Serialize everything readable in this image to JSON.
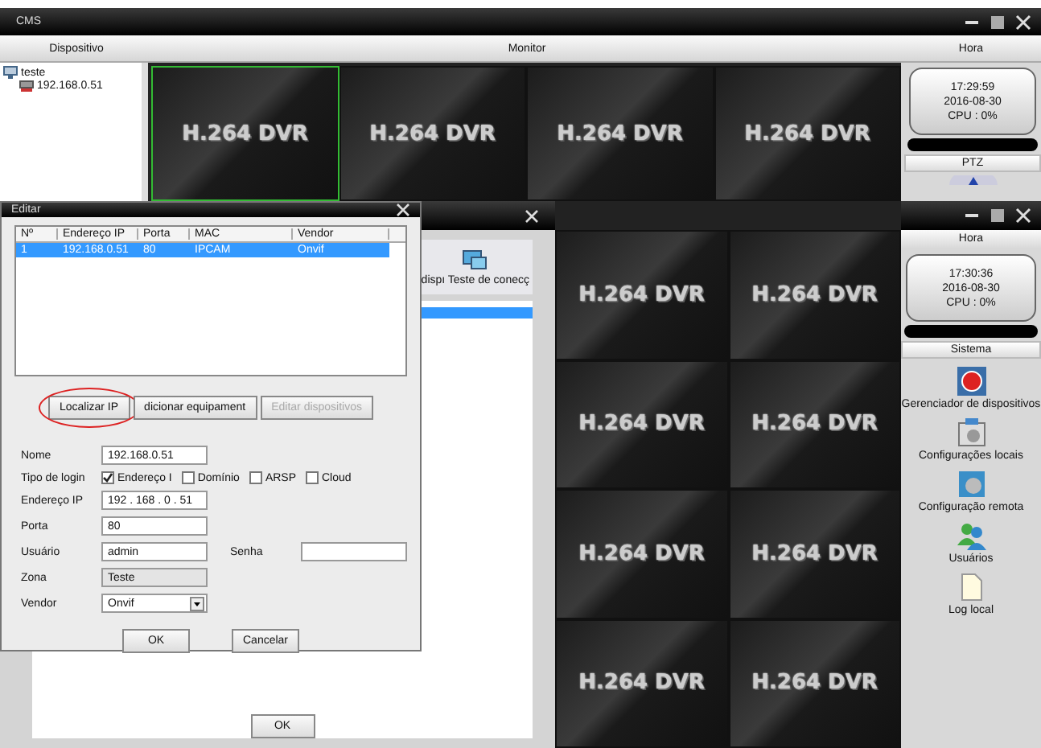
{
  "top_window": {
    "title": "CMS",
    "headers": [
      "Dispositivo",
      "Monitor",
      "Hora"
    ],
    "tree": [
      {
        "label": "teste",
        "children": [
          {
            "label": "192.168.0.51"
          }
        ]
      }
    ],
    "monitor_tiles": [
      {
        "label": "H.264 DVR",
        "selected": true
      },
      {
        "label": "H.264 DVR",
        "selected": false
      },
      {
        "label": "H.264 DVR",
        "selected": false
      },
      {
        "label": "H.264 DVR",
        "selected": false
      }
    ],
    "clock": {
      "time": "17:29:59",
      "date": "2016-08-30",
      "cpu": "CPU : 0%"
    },
    "ptz_label": "PTZ"
  },
  "bottom_window": {
    "device_window": {
      "toolbar_label": "dispı Teste de conecç",
      "button": "OK"
    },
    "monitor_tiles": [
      {
        "label": "H.264 DVR"
      },
      {
        "label": "H.264 DVR"
      },
      {
        "label": "H.264 DVR"
      },
      {
        "label": "H.264 DVR"
      },
      {
        "label": "H.264 DVR"
      },
      {
        "label": "H.264 DVR"
      },
      {
        "label": "H.264 DVR"
      },
      {
        "label": "H.264 DVR"
      }
    ],
    "header": "Hora",
    "clock": {
      "time": "17:30:36",
      "date": "2016-08-30",
      "cpu": "CPU : 0%"
    },
    "system": {
      "title": "Sistema",
      "items": [
        {
          "label": "Gerenciador de dispositivos",
          "kind": "record"
        },
        {
          "label": "Configurações locais",
          "kind": "local"
        },
        {
          "label": "Configuração remota",
          "kind": "remote"
        },
        {
          "label": "Usuários",
          "kind": "users"
        },
        {
          "label": "Log local",
          "kind": "log"
        }
      ]
    }
  },
  "dialog": {
    "title": "Editar",
    "columns": [
      "Nº",
      "Endereço IP",
      "Porta",
      "MAC",
      "Vendor"
    ],
    "rows": [
      {
        "cells": [
          "1",
          "192.168.0.51",
          "80",
          "IPCAM",
          "Onvif"
        ],
        "selected": true
      }
    ],
    "buttons": [
      {
        "label": "Localizar IP",
        "disabled": false,
        "circled": true
      },
      {
        "label": "dicionar equipament",
        "disabled": false,
        "circled": false
      },
      {
        "label": "Editar dispositivos",
        "disabled": true,
        "circled": false
      }
    ],
    "name": {
      "label": "Nome",
      "value": "192.168.0.51"
    },
    "login_type": {
      "label": "Tipo de login",
      "options": [
        {
          "label": "Endereço I",
          "checked": true
        },
        {
          "label": "Domínio",
          "checked": false
        },
        {
          "label": "ARSP",
          "checked": false
        },
        {
          "label": "Cloud",
          "checked": false
        }
      ]
    },
    "ip": {
      "label": "Endereço IP",
      "value": "192 . 168 . 0 . 51"
    },
    "port": {
      "label": "Porta",
      "value": "80"
    },
    "user": {
      "label": "Usuário",
      "value": "admin"
    },
    "password": {
      "label": "Senha"
    },
    "zone": {
      "label": "Zona",
      "value": "Teste",
      "disabled": true
    },
    "vendor": {
      "label": "Vendor",
      "value": "Onvif"
    },
    "ok": "OK",
    "cancel": "Cancelar"
  }
}
